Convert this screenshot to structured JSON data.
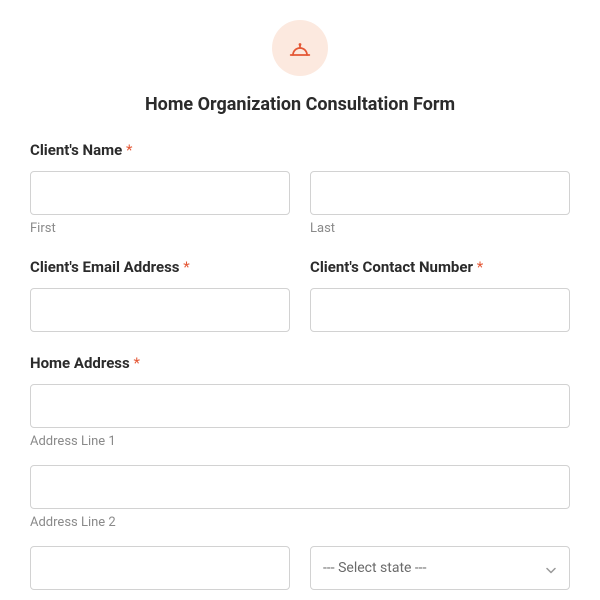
{
  "form": {
    "title": "Home Organization Consultation Form",
    "required_marker": "*"
  },
  "fields": {
    "client_name": {
      "label": "Client's Name",
      "first_sub": "First",
      "last_sub": "Last"
    },
    "email": {
      "label": "Client's Email Address"
    },
    "contact": {
      "label": "Client's Contact Number"
    },
    "address": {
      "label": "Home Address",
      "line1_sub": "Address Line 1",
      "line2_sub": "Address Line 2",
      "state_placeholder": "--- Select state ---"
    }
  }
}
